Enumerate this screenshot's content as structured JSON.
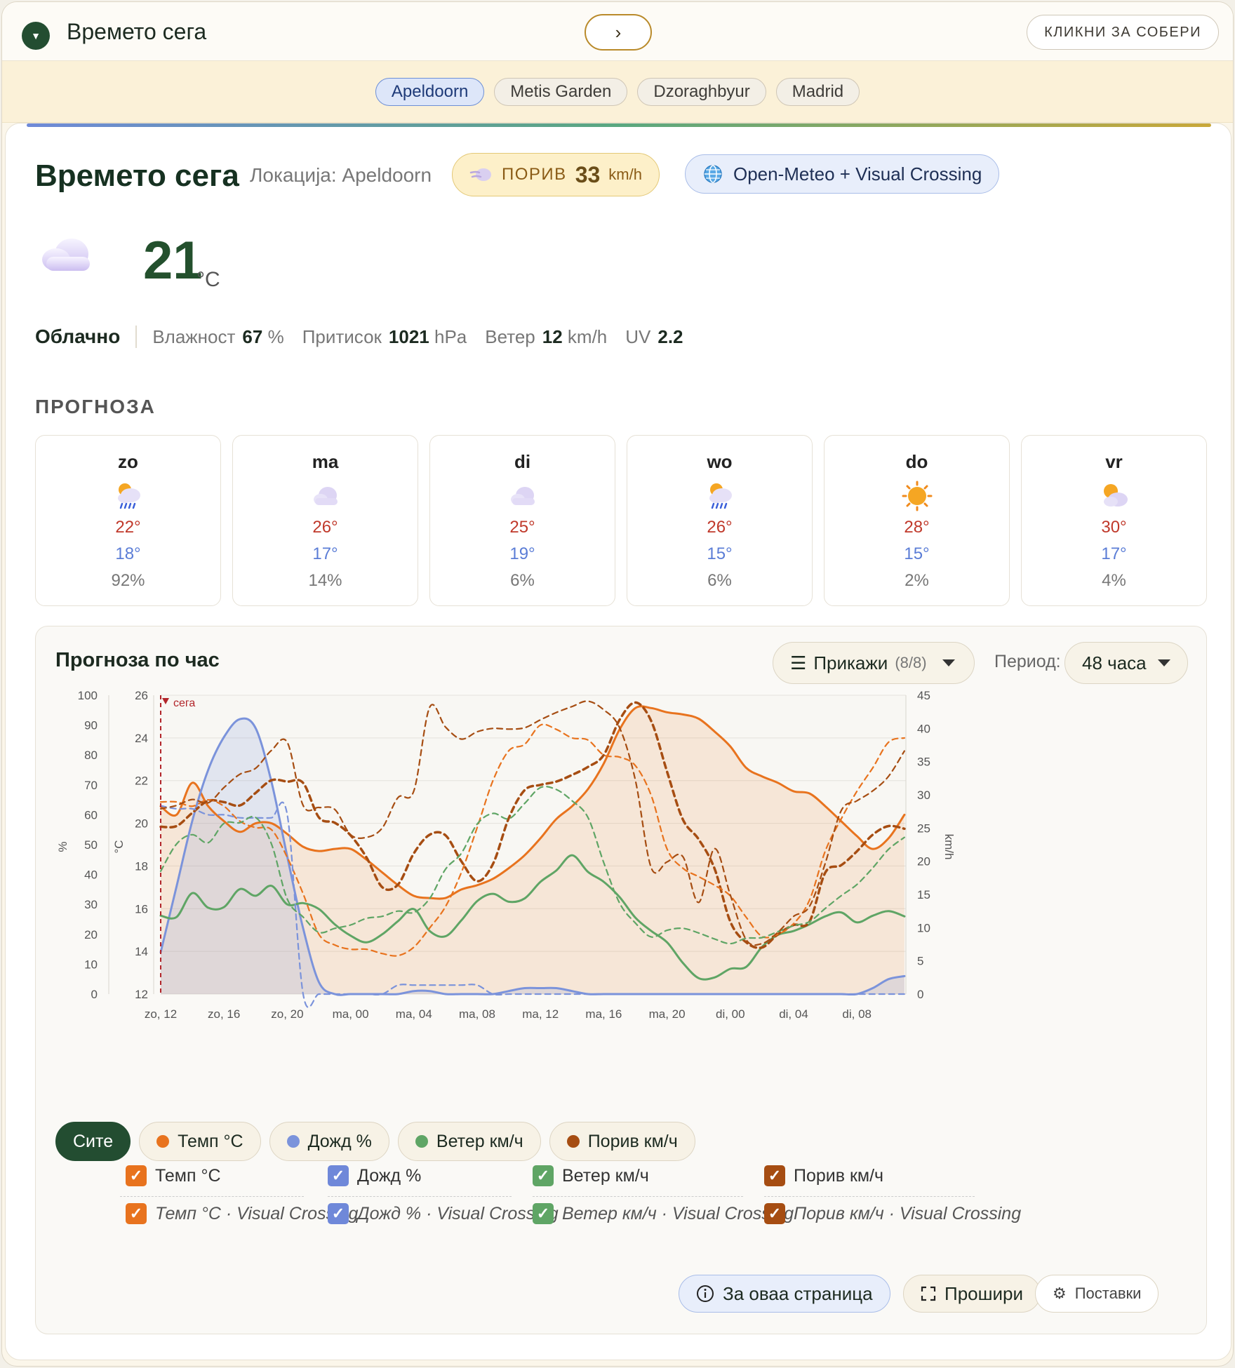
{
  "header": {
    "title": "Времето сега",
    "next_label": "›",
    "collapse_label": "КЛИКНИ ЗА СОБЕРИ"
  },
  "tabs": [
    {
      "label": "Apeldoorn",
      "active": true
    },
    {
      "label": "Metis Garden",
      "active": false
    },
    {
      "label": "Dzoraghbyur",
      "active": false
    },
    {
      "label": "Madrid",
      "active": false
    }
  ],
  "current": {
    "title": "Времето сега",
    "location": "Локација: Apeldoorn",
    "gust": {
      "label": "ПОРИВ",
      "value": "33",
      "unit": "km/h"
    },
    "source": "Open-Meteo + Visual Crossing",
    "temp": "21",
    "temp_unit": "°C",
    "icon": "cloud-icon",
    "condition": "Облачно",
    "humidity_label": "Влажност",
    "humidity": "67",
    "humidity_unit": "%",
    "pressure_label": "Притисок",
    "pressure": "1021",
    "pressure_unit": "hPa",
    "wind_label": "Ветер",
    "wind": "12",
    "wind_unit": "km/h",
    "uv_label": "UV",
    "uv": "2.2"
  },
  "forecast": {
    "label": "ПРОГНОЗА",
    "days": [
      {
        "day": "zo",
        "icon": "sun-rain-icon",
        "hi": "22°",
        "lo": "18°",
        "precip": "92%"
      },
      {
        "day": "ma",
        "icon": "cloud-icon",
        "hi": "26°",
        "lo": "17°",
        "precip": "14%"
      },
      {
        "day": "di",
        "icon": "cloud-icon",
        "hi": "25°",
        "lo": "19°",
        "precip": "6%"
      },
      {
        "day": "wo",
        "icon": "sun-rain-icon",
        "hi": "26°",
        "lo": "15°",
        "precip": "6%"
      },
      {
        "day": "do",
        "icon": "sun-icon",
        "hi": "28°",
        "lo": "15°",
        "precip": "2%"
      },
      {
        "day": "vr",
        "icon": "sun-cloud-icon",
        "hi": "30°",
        "lo": "17°",
        "precip": "4%"
      }
    ]
  },
  "hourly": {
    "title": "Прогноза по час",
    "show_label": "Прикажи",
    "show_count": "(8/8)",
    "period_label": "Период:",
    "period_value": "48 часа",
    "now_label": "сега",
    "chips": [
      {
        "label": "Сите",
        "color": ""
      },
      {
        "label": "Темп °C",
        "color": "#e8731e"
      },
      {
        "label": "Дожд %",
        "color": "#7b93db"
      },
      {
        "label": "Ветер км/ч",
        "color": "#5fa565"
      },
      {
        "label": "Порив км/ч",
        "color": "#a64d12"
      }
    ],
    "checks": [
      {
        "label": "Темп °C",
        "color": "#e8731e",
        "italic": false
      },
      {
        "label": "Дожд %",
        "color": "#6f88d9",
        "italic": false
      },
      {
        "label": "Ветер км/ч",
        "color": "#5fa565",
        "italic": false
      },
      {
        "label": "Порив км/ч",
        "color": "#a64d12",
        "italic": false
      },
      {
        "label": "Темп °C · Visual Crossing",
        "color": "#e8731e",
        "italic": true
      },
      {
        "label": "Дожд % · Visual Crossing",
        "color": "#6f88d9",
        "italic": true
      },
      {
        "label": "Ветер км/ч · Visual Crossing",
        "color": "#5fa565",
        "italic": true
      },
      {
        "label": "Порив км/ч · Visual Crossing",
        "color": "#a64d12",
        "italic": true
      }
    ],
    "footer": {
      "about": "За оваа страница",
      "expand": "Прошири",
      "settings": "Поставки"
    }
  },
  "chart_data": {
    "type": "line",
    "xlabel": "",
    "x_ticks": [
      "zo, 12",
      "zo, 16",
      "zo, 20",
      "ma, 00",
      "ma, 04",
      "ma, 08",
      "ma, 12",
      "ma, 16",
      "ma, 20",
      "di, 00",
      "di, 04",
      "di, 08"
    ],
    "x_hours": [
      12,
      13,
      14,
      15,
      16,
      17,
      18,
      19,
      20,
      21,
      22,
      23,
      24,
      25,
      26,
      27,
      28,
      29,
      30,
      31,
      32,
      33,
      34,
      35,
      36,
      37,
      38,
      39,
      40,
      41,
      42,
      43,
      44,
      45,
      46,
      47,
      48,
      49,
      50,
      51,
      52,
      53,
      54,
      55,
      56,
      57,
      58,
      59
    ],
    "y_axes": [
      {
        "label": "%",
        "ticks": [
          0,
          10,
          20,
          30,
          40,
          50,
          60,
          70,
          80,
          90,
          100
        ],
        "range": [
          0,
          100
        ]
      },
      {
        "label": "°C",
        "ticks": [
          12,
          14,
          16,
          18,
          20,
          22,
          24,
          26
        ],
        "range": [
          12,
          26
        ]
      },
      {
        "label": "km/h",
        "ticks": [
          0,
          5,
          10,
          15,
          20,
          25,
          30,
          35,
          40,
          45
        ],
        "range": [
          0,
          45
        ]
      }
    ],
    "series": [
      {
        "name": "Темп °C",
        "axis": 1,
        "color": "#e8731e",
        "dash": false,
        "fill": true,
        "values": [
          20.8,
          20.4,
          21.9,
          20.8,
          20.1,
          19.6,
          20.0,
          20.0,
          19.5,
          18.9,
          18.7,
          18.8,
          18.8,
          18.3,
          17.7,
          17.1,
          16.6,
          16.5,
          16.5,
          16.9,
          17.1,
          17.4,
          17.9,
          18.5,
          19.3,
          20.2,
          20.8,
          21.6,
          22.8,
          24.4,
          25.4,
          25.4,
          25.2,
          25.1,
          24.9,
          24.3,
          23.6,
          22.6,
          22.2,
          21.9,
          21.5,
          21.4,
          20.8,
          20.1,
          19.4,
          18.8,
          19.3,
          20.4
        ]
      },
      {
        "name": "Дожд %",
        "axis": 0,
        "color": "#7b93db",
        "dash": false,
        "fill": true,
        "values": [
          14,
          36,
          58,
          75,
          86,
          92,
          89,
          71,
          46,
          22,
          4,
          0,
          0,
          0,
          0,
          0,
          1,
          1,
          0,
          0,
          0,
          0,
          1,
          2,
          2,
          2,
          1,
          0,
          0,
          0,
          0,
          0,
          0,
          0,
          0,
          0,
          0,
          0,
          0,
          0,
          0,
          0,
          0,
          0,
          0,
          2,
          5,
          6
        ]
      },
      {
        "name": "Ветер км/ч",
        "axis": 2,
        "color": "#5fa565",
        "dash": false,
        "fill": false,
        "values": [
          11.8,
          11.6,
          15.2,
          13.0,
          13.1,
          15.8,
          14.8,
          16.3,
          13.5,
          13.7,
          12.8,
          10.5,
          8.8,
          7.8,
          9.0,
          11.0,
          12.8,
          9.5,
          8.7,
          11.1,
          14.0,
          15.1,
          13.9,
          14.4,
          16.9,
          18.6,
          20.9,
          18.4,
          16.9,
          14.6,
          11.5,
          9.5,
          7.8,
          4.7,
          2.4,
          2.5,
          3.8,
          4.1,
          7.1,
          8.9,
          9.5,
          10.5,
          11.7,
          12.3,
          10.8,
          11.8,
          12.5,
          11.7
        ]
      },
      {
        "name": "Порив км/ч",
        "axis": 2,
        "color": "#a64d12",
        "dash": true,
        "width": 3.5,
        "fill": false,
        "values": [
          25.2,
          25.3,
          27.3,
          29.1,
          28.9,
          28.4,
          30.3,
          32.2,
          32.0,
          31.8,
          26.6,
          25.8,
          23.9,
          20.6,
          16.1,
          16.5,
          21.2,
          24.0,
          23.9,
          20.0,
          17.0,
          19.6,
          26.5,
          30.7,
          31.5,
          32.0,
          33.0,
          34.2,
          36.0,
          41.3,
          43.9,
          41.1,
          33.5,
          26.3,
          23.3,
          18.9,
          10.9,
          7.8,
          7.0,
          9.0,
          10.4,
          10.9,
          18.3,
          19.4,
          21.5,
          24.0,
          25.3,
          24.9
        ]
      },
      {
        "name": "Темп °C · Visual Crossing",
        "axis": 1,
        "color": "#e8731e",
        "dash": true,
        "fill": false,
        "values": [
          21.0,
          21.0,
          20.8,
          21.1,
          20.8,
          20.1,
          19.8,
          19.7,
          18.4,
          16.7,
          14.8,
          14.3,
          14.1,
          14.1,
          13.9,
          13.8,
          14.2,
          15.1,
          16.1,
          17.7,
          19.8,
          22.0,
          23.4,
          23.7,
          24.6,
          24.4,
          24.0,
          23.9,
          23.2,
          23.1,
          22.7,
          21.3,
          18.8,
          17.9,
          17.5,
          17.1,
          16.6,
          15.6,
          14.7,
          14.8,
          15.3,
          16.4,
          18.7,
          20.2,
          21.5,
          22.6,
          23.8,
          24.0
        ]
      },
      {
        "name": "Дожд % · Visual Crossing",
        "axis": 0,
        "color": "#7b93db",
        "dash": true,
        "fill": false,
        "values": [
          63,
          62,
          62,
          60,
          60,
          59,
          59,
          59,
          60,
          0,
          0,
          0,
          0,
          0,
          0,
          3,
          3,
          3,
          3,
          3,
          3,
          0,
          0,
          0,
          0,
          0,
          0,
          0,
          0,
          0,
          0,
          0,
          0,
          0,
          0,
          0,
          0,
          0,
          0,
          0,
          0,
          0,
          0,
          0,
          0,
          0,
          0,
          0
        ]
      },
      {
        "name": "Ветер км/ч · Visual Crossing",
        "axis": 2,
        "color": "#5fa565",
        "dash": true,
        "fill": false,
        "values": [
          18.5,
          22.6,
          24.0,
          22.8,
          25.7,
          25.8,
          26.6,
          22.6,
          14.3,
          11.6,
          9.3,
          9.9,
          10.4,
          11.4,
          11.7,
          12.5,
          12.3,
          14.4,
          18.8,
          21.2,
          25.6,
          27.2,
          26.4,
          28.7,
          31.1,
          30.8,
          29.1,
          26.6,
          19.8,
          13.7,
          10.7,
          8.6,
          9.6,
          9.9,
          9.2,
          8.3,
          7.6,
          8.4,
          8.5,
          9.4,
          10.3,
          10.9,
          12.9,
          14.8,
          16.5,
          19.0,
          21.8,
          23.6
        ]
      },
      {
        "name": "Порив км/ч · Visual Crossing",
        "axis": 2,
        "color": "#a64d12",
        "dash": true,
        "fill": false,
        "values": [
          27.9,
          28.4,
          29.3,
          28.8,
          31.1,
          33.1,
          34.0,
          36.7,
          37.9,
          28.4,
          28.1,
          27.8,
          24.0,
          23.6,
          25.0,
          29.6,
          30.6,
          43.2,
          40.2,
          38.4,
          39.5,
          40.0,
          39.9,
          40.1,
          41.3,
          42.4,
          43.3,
          44.1,
          42.8,
          40.1,
          32.2,
          19.0,
          19.9,
          20.7,
          13.8,
          21.9,
          14.9,
          8.2,
          7.6,
          9.3,
          11.7,
          13.2,
          19.7,
          27.6,
          29.1,
          30.6,
          32.8,
          36.6
        ]
      }
    ]
  }
}
